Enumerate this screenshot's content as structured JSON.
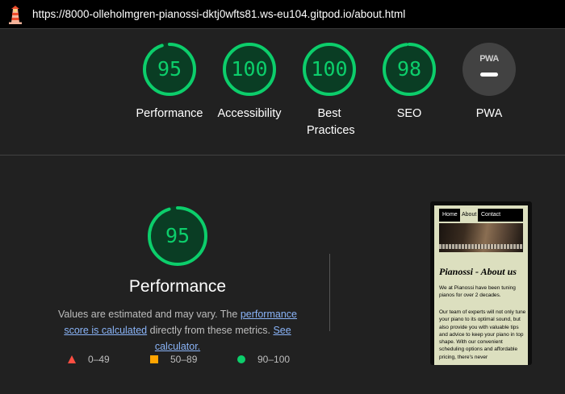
{
  "browser": {
    "url": "https://8000-olleholmgren-pianossi-dktj0wfts81.ws-eu104.gitpod.io/about.html",
    "logo_icon": "lighthouse-icon"
  },
  "category_gauges": [
    {
      "id": "performance",
      "score": "95",
      "label": "Performance",
      "fraction": 0.95
    },
    {
      "id": "accessibility",
      "score": "100",
      "label": "Accessibility",
      "fraction": 1.0
    },
    {
      "id": "best-practices",
      "score": "100",
      "label": "Best Practices",
      "fraction": 1.0
    },
    {
      "id": "seo",
      "score": "98",
      "label": "SEO",
      "fraction": 0.98
    }
  ],
  "pwa": {
    "badge_text": "PWA",
    "label": "PWA"
  },
  "performance": {
    "score": "95",
    "fraction": 0.95,
    "title": "Performance",
    "desc_text_1": "Values are estimated and may vary. The ",
    "desc_link_1": "performance score is calculated",
    "desc_text_2": " directly from these metrics. ",
    "desc_link_2": "See calculator."
  },
  "legend": [
    {
      "range": "0–49",
      "icon": "red-triangle-icon"
    },
    {
      "range": "50–89",
      "icon": "orange-square-icon"
    },
    {
      "range": "90–100",
      "icon": "green-circle-icon"
    }
  ],
  "screenshot": {
    "nav": [
      "Home",
      "About",
      "Contact"
    ],
    "active_nav": "About",
    "title": "Pianossi - About us",
    "paragraph_1": "We at Pianossi have been tuning pianos for over 2 decades.",
    "paragraph_2": "Our team of experts will not only tune your piano to its optimal sound, but also provide you with valuable tips and advice to keep your piano in top shape. With our convenient scheduling options and affordable pricing, there's never"
  },
  "colors": {
    "pass": "#0cce6b",
    "pass_bg": "#0a3d24",
    "average": "#ffa400",
    "fail": "#ff4e42",
    "link": "#8ab4f8",
    "background": "#212121"
  }
}
